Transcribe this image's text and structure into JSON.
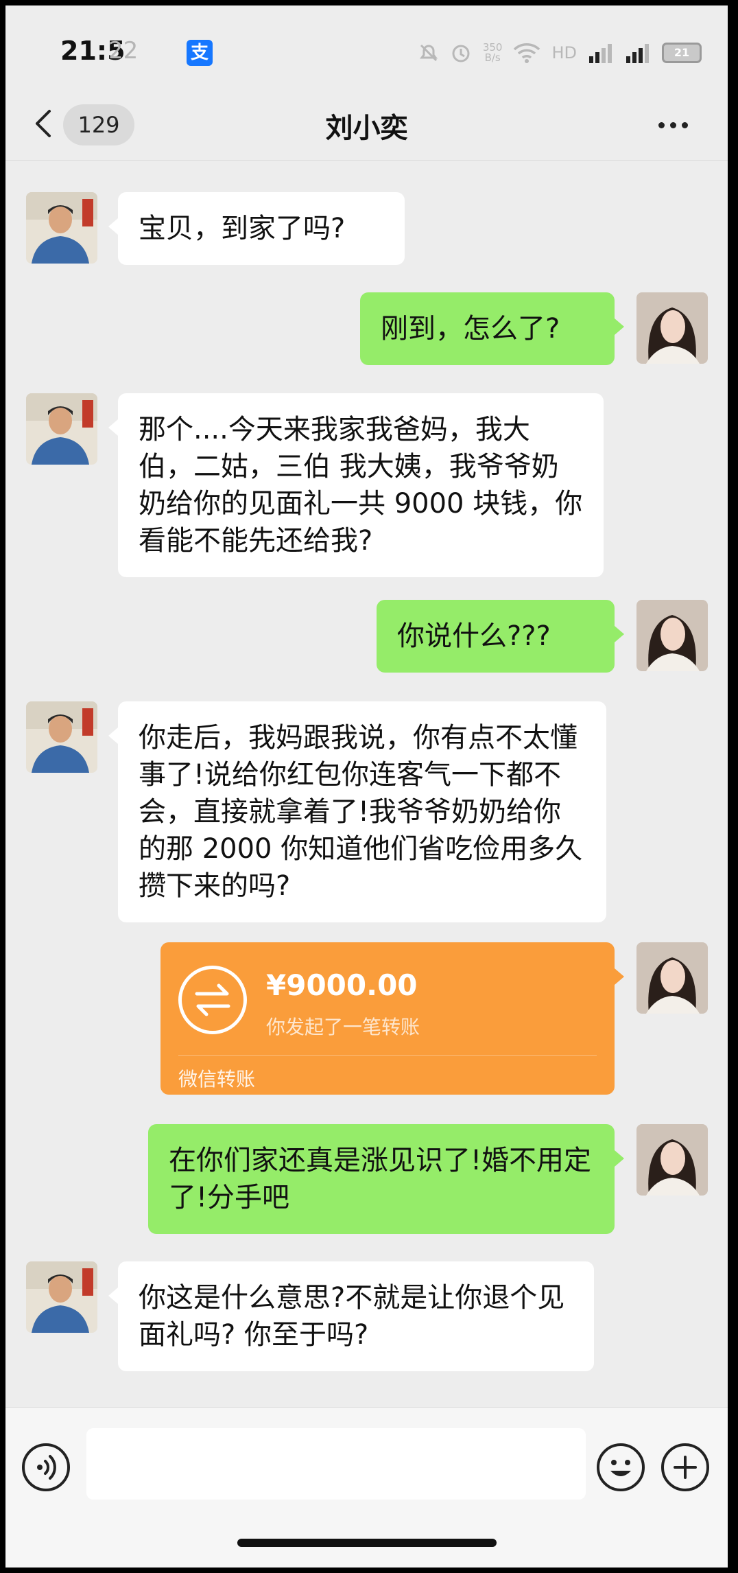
{
  "status": {
    "time": "21:5",
    "time_overlay": "22",
    "alipay_icon_text": "支",
    "speed_top": "350",
    "speed_bottom": "B/s",
    "network": "HD",
    "battery": "21"
  },
  "header": {
    "unread_count": "129",
    "contact_name": "刘小奕"
  },
  "messages": [
    {
      "side": "left",
      "text": "宝贝，到家了吗?"
    },
    {
      "side": "right",
      "text": "刚到，怎么了?"
    },
    {
      "side": "left",
      "text": "那个....今天来我家我爸妈，我大伯，二姑，三伯 我大姨，我爷爷奶奶给你的见面礼一共 9000 块钱，你看能不能先还给我?"
    },
    {
      "side": "right",
      "text": "你说什么???"
    },
    {
      "side": "left",
      "text": "你走后，我妈跟我说，你有点不太懂事了!说给你红包你连客气一下都不会，直接就拿着了!我爷爷奶奶给你的那 2000 你知道他们省吃俭用多久攒下来的吗?"
    },
    {
      "side": "right",
      "type": "transfer",
      "amount": "¥9000.00",
      "description": "你发起了一笔转账",
      "label": "微信转账"
    },
    {
      "side": "right",
      "text": "在你们家还真是涨见识了!婚不用定了!分手吧"
    },
    {
      "side": "left",
      "text": "你这是什么意思?不就是让你退个见面礼吗? 你至于吗?"
    }
  ],
  "input": {
    "placeholder": ""
  },
  "icons": {
    "back": "chevron-left-icon",
    "more": "more-dots-icon",
    "voice": "voice-icon",
    "emoji": "emoji-icon",
    "plus": "plus-icon",
    "transfer": "transfer-arrows-icon"
  },
  "colors": {
    "bubble_sent": "#95ec69",
    "bubble_received": "#ffffff",
    "transfer_card": "#fa9d3b",
    "background": "#ededed"
  }
}
